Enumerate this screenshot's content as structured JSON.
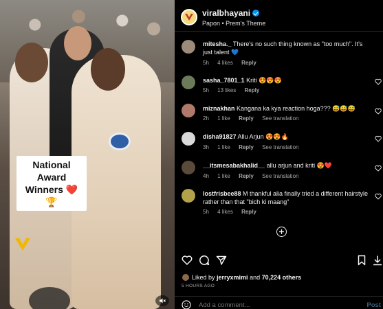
{
  "media": {
    "overlay_line1": "National Award",
    "overlay_line2": "Winners ❤️ 🏆"
  },
  "header": {
    "username": "viralbhayani",
    "subtitle": "Papon • Prem's Theme"
  },
  "comments": [
    {
      "user": "mitesha._",
      "text": " There's no such thing known as \"too much\". It's just talent 💙",
      "time": "5h",
      "likes": "4 likes",
      "reply": "Reply",
      "translation": "",
      "avatar_color": "#9c8a7a"
    },
    {
      "user": "sasha_7801_1",
      "text": " Kriti 😍😍😍",
      "time": "5h",
      "likes": "13 likes",
      "reply": "Reply",
      "translation": "",
      "avatar_color": "#6b7b5a"
    },
    {
      "user": "miznakhan",
      "text": " Kangana ka kya reaction hoga??? 😅😅😅",
      "time": "2h",
      "likes": "1 like",
      "reply": "Reply",
      "translation": "See translation",
      "avatar_color": "#b07a6a"
    },
    {
      "user": "disha91827",
      "text": " Allu Arjun 😍😍🔥",
      "time": "3h",
      "likes": "1 like",
      "reply": "Reply",
      "translation": "See translation",
      "avatar_color": "#d9d9d9"
    },
    {
      "user": "__itsmesabakhalid__",
      "text": " allu arjun and kriti 😍❤️",
      "time": "4h",
      "likes": "1 like",
      "reply": "Reply",
      "translation": "See translation",
      "avatar_color": "#5a4a3a"
    },
    {
      "user": "lostfrisbee88",
      "text": " M thankful alia finally tried a different hairstyle rather than that \"bich ki maang\"",
      "time": "5h",
      "likes": "4 likes",
      "reply": "Reply",
      "translation": "",
      "avatar_color": "#b3a24a"
    }
  ],
  "footer": {
    "liked_prefix": "Liked by ",
    "liked_user": "jerryxmimi",
    "liked_and": " and ",
    "liked_count": "70,224 others",
    "time": "5 HOURS AGO",
    "comment_placeholder": "Add a comment...",
    "post_label": "Post"
  },
  "colors": {
    "accent": "#0095f6",
    "background": "#000000",
    "heart": "#ed4956"
  }
}
